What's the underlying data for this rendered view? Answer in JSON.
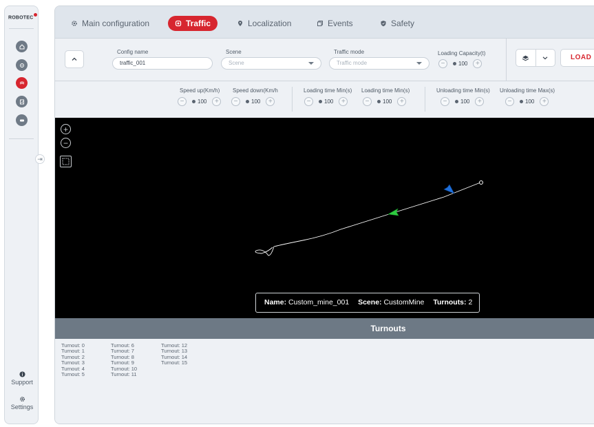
{
  "sidebar": {
    "logo": "ROBOTEC",
    "nav": [
      {
        "icon": "home-icon",
        "active": false
      },
      {
        "icon": "settings-gear-icon",
        "active": false
      },
      {
        "icon": "traffic-icon",
        "active": true
      },
      {
        "icon": "events-icon",
        "active": false
      },
      {
        "icon": "safety-icon",
        "active": false
      }
    ],
    "support_label": "Support",
    "settings_label": "Settings",
    "accent": "#d7262f"
  },
  "tabs": [
    {
      "label": "Main configuration",
      "icon": "gear-icon",
      "active": false
    },
    {
      "label": "Traffic",
      "icon": "traffic-icon",
      "active": true
    },
    {
      "label": "Localization",
      "icon": "location-pin-icon",
      "active": false
    },
    {
      "label": "Events",
      "icon": "events-icon",
      "active": false
    },
    {
      "label": "Safety",
      "icon": "shield-icon",
      "active": false
    }
  ],
  "config": {
    "config_name_label": "Config name",
    "config_name_value": "traffic_001",
    "scene_label": "Scene",
    "scene_placeholder": "Scene",
    "traffic_mode_label": "Traffic mode",
    "traffic_mode_placeholder": "Traffic mode",
    "loading_capacity_label": "Loading Capacity(t)",
    "loading_capacity_value": "100",
    "load_button": "LOAD U"
  },
  "speed": {
    "speed_up_label": "Speed up(Km/h)",
    "speed_up_value": "100",
    "speed_down_label": "Speed down(Km/h",
    "speed_down_value": "100",
    "loading_min_label": "Loading time Min(s)",
    "loading_min_value": "100",
    "loading_max_label": "Loading time Min(s)",
    "loading_max_value": "100",
    "unloading_min_label": "Unloading time Min(s)",
    "unloading_min_value": "100",
    "unloading_max_label": "Unloading time Max(s)",
    "unloading_max_value": "100"
  },
  "map": {
    "info": {
      "name_label": "Name:",
      "name_value": "Custom_mine_001",
      "scene_label": "Scene:",
      "scene_value": "CustomMine",
      "turnouts_label": "Turnouts:",
      "turnouts_value": "2"
    },
    "marker_colors": {
      "green": "#2ecc40",
      "blue": "#1e6fd9"
    }
  },
  "turnouts": {
    "title": "Turnouts",
    "col1": [
      "Turnout: 0",
      "Turnout: 1",
      "Turnout: 2",
      "Turnout: 3",
      "Turnout: 4",
      "Turnout: 5"
    ],
    "col2": [
      "Turnout: 6",
      "Turnout: 7",
      "Turnout: 8",
      "Turnout: 9",
      "Turnout: 10",
      "Turnout: 11"
    ],
    "col3": [
      "Turnout: 12",
      "Turnout: 13",
      "Turnout: 14",
      "Turnout: 15"
    ]
  }
}
